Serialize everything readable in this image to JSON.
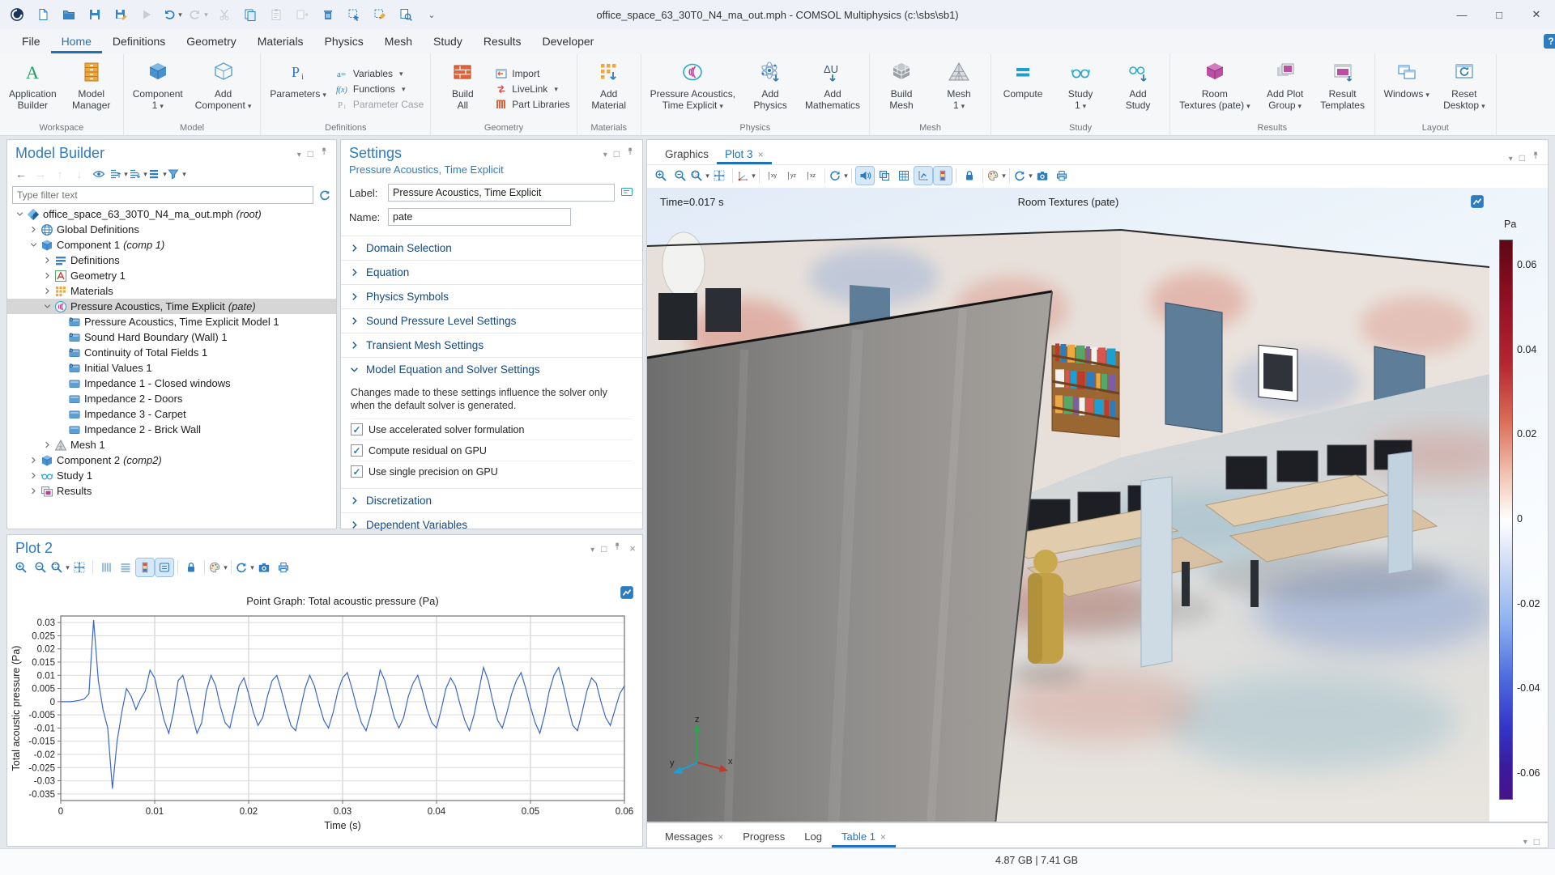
{
  "window": {
    "title": "office_space_63_30T0_N4_ma_out.mph - COMSOL Multiphysics (c:\\sbs\\sb1)",
    "quick_access": [
      {
        "icon": "comsol-logo"
      },
      {
        "icon": "new-file"
      },
      {
        "icon": "open"
      },
      {
        "icon": "save"
      },
      {
        "icon": "save-as"
      },
      {
        "icon": "run",
        "disabled": true
      },
      {
        "icon": "undo",
        "caret": true
      },
      {
        "icon": "redo",
        "caret": true,
        "disabled": true
      },
      {
        "icon": "cut",
        "disabled": true
      },
      {
        "icon": "copy"
      },
      {
        "icon": "paste",
        "disabled": true
      },
      {
        "icon": "duplicate",
        "disabled": true
      },
      {
        "icon": "delete"
      },
      {
        "icon": "select-box"
      },
      {
        "icon": "clear-selection"
      },
      {
        "icon": "find"
      },
      {
        "icon": "more-chevron"
      }
    ],
    "controls": [
      {
        "icon": "minimize",
        "glyph": "—"
      },
      {
        "icon": "maximize",
        "glyph": "□"
      },
      {
        "icon": "close",
        "glyph": "✕"
      }
    ]
  },
  "menu": {
    "items": [
      "File",
      "Home",
      "Definitions",
      "Geometry",
      "Materials",
      "Physics",
      "Mesh",
      "Study",
      "Results",
      "Developer"
    ],
    "active": "Home",
    "help": "?"
  },
  "ribbon": {
    "groups": [
      {
        "label": "Workspace",
        "buttons": [
          {
            "lines": [
              "Application",
              "Builder"
            ],
            "icon": "app-builder"
          },
          {
            "lines": [
              "Model",
              "Manager"
            ],
            "icon": "model-manager"
          }
        ]
      },
      {
        "label": "Model",
        "buttons": [
          {
            "lines": [
              "Component",
              "1"
            ],
            "icon": "component-cube",
            "caret": true
          },
          {
            "lines": [
              "Add",
              "Component"
            ],
            "icon": "add-component",
            "caret": true
          }
        ]
      },
      {
        "label": "Definitions",
        "buttons": [
          {
            "lines": [
              "Parameters"
            ],
            "icon": "parameters",
            "caret": true
          }
        ],
        "small": [
          {
            "label": "Variables",
            "icon": "variables",
            "caret": true
          },
          {
            "label": "Functions",
            "icon": "functions",
            "caret": true
          },
          {
            "label": "Parameter Case",
            "icon": "parameter-case",
            "disabled": true
          }
        ]
      },
      {
        "label": "Geometry",
        "buttons": [
          {
            "lines": [
              "Build",
              "All"
            ],
            "icon": "build-all"
          }
        ],
        "small": [
          {
            "label": "Import",
            "icon": "import"
          },
          {
            "label": "LiveLink",
            "icon": "livelink",
            "caret": true
          },
          {
            "label": "Part Libraries",
            "icon": "part-libraries"
          }
        ]
      },
      {
        "label": "Materials",
        "buttons": [
          {
            "lines": [
              "Add",
              "Material"
            ],
            "icon": "add-material"
          }
        ]
      },
      {
        "label": "Physics",
        "buttons": [
          {
            "lines": [
              "Pressure Acoustics,",
              "Time Explicit"
            ],
            "icon": "acoustics",
            "caret": true
          },
          {
            "lines": [
              "Add",
              "Physics"
            ],
            "icon": "add-physics"
          },
          {
            "lines": [
              "Add",
              "Mathematics"
            ],
            "icon": "add-math"
          }
        ]
      },
      {
        "label": "Mesh",
        "buttons": [
          {
            "lines": [
              "Build",
              "Mesh"
            ],
            "icon": "build-mesh"
          },
          {
            "lines": [
              "Mesh",
              "1"
            ],
            "icon": "mesh-tri",
            "caret": true
          }
        ]
      },
      {
        "label": "Study",
        "buttons": [
          {
            "lines": [
              "Compute"
            ],
            "icon": "compute"
          },
          {
            "lines": [
              "Study",
              "1"
            ],
            "icon": "study-glasses",
            "caret": true
          },
          {
            "lines": [
              "Add",
              "Study"
            ],
            "icon": "add-study"
          }
        ]
      },
      {
        "label": "Results",
        "buttons": [
          {
            "lines": [
              "Room",
              "Textures (pate)"
            ],
            "icon": "room-textures",
            "caret": true
          },
          {
            "lines": [
              "Add Plot",
              "Group"
            ],
            "icon": "add-plot-group",
            "caret": true
          },
          {
            "lines": [
              "Result",
              "Templates"
            ],
            "icon": "result-templates"
          }
        ]
      },
      {
        "label": "Layout",
        "buttons": [
          {
            "lines": [
              "Windows"
            ],
            "icon": "windows-icon",
            "caret": true
          },
          {
            "lines": [
              "Reset",
              "Desktop"
            ],
            "icon": "reset-desktop",
            "caret": true
          }
        ]
      }
    ]
  },
  "model_builder": {
    "title": "Model Builder",
    "toolbar": [
      {
        "icon": "arrow-left"
      },
      {
        "icon": "arrow-right",
        "disabled": true
      },
      {
        "icon": "arrow-up",
        "disabled": true
      },
      {
        "icon": "arrow-down",
        "disabled": true
      },
      {
        "icon": "eye"
      },
      {
        "icon": "expand-all",
        "caret": true
      },
      {
        "icon": "collapse-all",
        "caret": true
      },
      {
        "icon": "columns-icon",
        "caret": true
      },
      {
        "icon": "funnel",
        "caret": true
      }
    ],
    "filter_placeholder": "Type filter text",
    "tree": [
      {
        "depth": 0,
        "icon": "root",
        "label": "office_space_63_30T0_N4_ma_out.mph",
        "suffix": "(root)",
        "state": "expanded"
      },
      {
        "depth": 1,
        "icon": "globe",
        "label": "Global Definitions",
        "state": "collapsed"
      },
      {
        "depth": 1,
        "icon": "component",
        "label": "Component 1",
        "suffix": "(comp 1)",
        "state": "expanded"
      },
      {
        "depth": 2,
        "icon": "definitions",
        "label": "Definitions",
        "state": "collapsed"
      },
      {
        "depth": 2,
        "icon": "geometry",
        "label": "Geometry 1",
        "state": "collapsed"
      },
      {
        "depth": 2,
        "icon": "materials",
        "label": "Materials",
        "state": "collapsed"
      },
      {
        "depth": 2,
        "icon": "physics",
        "label": "Pressure Acoustics, Time Explicit",
        "suffix": "(pate)",
        "state": "expanded",
        "selected": true
      },
      {
        "depth": 3,
        "icon": "node-d",
        "label": "Pressure Acoustics, Time Explicit Model 1"
      },
      {
        "depth": 3,
        "icon": "node-d",
        "label": "Sound Hard Boundary (Wall) 1"
      },
      {
        "depth": 3,
        "icon": "node-d",
        "label": "Continuity of Total Fields 1"
      },
      {
        "depth": 3,
        "icon": "node-d",
        "label": "Initial Values 1"
      },
      {
        "depth": 3,
        "icon": "node",
        "label": "Impedance 1 - Closed windows"
      },
      {
        "depth": 3,
        "icon": "node",
        "label": "Impedance 2 - Doors"
      },
      {
        "depth": 3,
        "icon": "node",
        "label": "Impedance 3 - Carpet"
      },
      {
        "depth": 3,
        "icon": "node",
        "label": "Impedance 2 - Brick Wall"
      },
      {
        "depth": 2,
        "icon": "mesh",
        "label": "Mesh 1",
        "state": "collapsed"
      },
      {
        "depth": 1,
        "icon": "component",
        "label": "Component 2",
        "suffix": "(comp2)",
        "state": "collapsed"
      },
      {
        "depth": 1,
        "icon": "study",
        "label": "Study 1",
        "state": "collapsed"
      },
      {
        "depth": 1,
        "icon": "results",
        "label": "Results",
        "state": "collapsed"
      }
    ]
  },
  "settings": {
    "title": "Settings",
    "subtitle": "Pressure Acoustics, Time Explicit",
    "label_caption": "Label:",
    "label_value": "Pressure Acoustics, Time Explicit",
    "name_caption": "Name:",
    "name_value": "pate",
    "sections": [
      {
        "title": "Domain Selection",
        "state": "collapsed"
      },
      {
        "title": "Equation",
        "state": "collapsed"
      },
      {
        "title": "Physics Symbols",
        "state": "collapsed"
      },
      {
        "title": "Sound Pressure Level Settings",
        "state": "collapsed"
      },
      {
        "title": "Transient Mesh Settings",
        "state": "collapsed"
      },
      {
        "title": "Model Equation and Solver Settings",
        "state": "expanded",
        "note": "Changes made to these settings influence the solver only when the default solver is generated.",
        "checkboxes": [
          {
            "label": "Use accelerated solver formulation",
            "checked": true
          },
          {
            "label": "Compute residual on GPU",
            "checked": true
          },
          {
            "label": "Use single precision on GPU",
            "checked": true
          }
        ]
      },
      {
        "title": "Discretization",
        "state": "collapsed"
      },
      {
        "title": "Dependent Variables",
        "state": "collapsed"
      }
    ]
  },
  "plot2": {
    "title": "Plot 2",
    "toolbar": [
      {
        "icon": "zoom-in"
      },
      {
        "icon": "zoom-out"
      },
      {
        "icon": "zoom-box",
        "caret": true
      },
      {
        "icon": "zoom-extents",
        "sep": true
      },
      {
        "icon": "grid-x"
      },
      {
        "icon": "grid-y"
      },
      {
        "icon": "colorbar-icon",
        "active": true
      },
      {
        "icon": "legend-icon",
        "active": true,
        "sep": true
      },
      {
        "icon": "lock",
        "sep": true
      },
      {
        "icon": "palette",
        "caret": true,
        "sep": true
      },
      {
        "icon": "update",
        "caret": true
      },
      {
        "icon": "camera"
      },
      {
        "icon": "print"
      }
    ],
    "chart_data": {
      "type": "line",
      "title": "Point Graph: Total acoustic pressure (Pa)",
      "xlabel": "Time (s)",
      "ylabel": "Total acoustic pressure (Pa)",
      "xlim": [
        0,
        0.06
      ],
      "ylim": [
        -0.0375,
        0.0325
      ],
      "xticks": [
        0,
        0.01,
        0.02,
        0.03,
        0.04,
        0.05,
        0.06
      ],
      "xtick_labels": [
        "0",
        "0.01",
        "0.02",
        "0.03",
        "0.04",
        "0.05",
        "0.06"
      ],
      "yticks": [
        0.03,
        0.025,
        0.02,
        0.015,
        0.01,
        0.005,
        0,
        -0.005,
        -0.01,
        -0.015,
        -0.02,
        -0.025,
        -0.03,
        -0.035
      ],
      "ytick_labels": [
        "0.03",
        "0.025",
        "0.02",
        "0.015",
        "0.01",
        "0.005",
        "0",
        "-0.005",
        "-0.01",
        "-0.015",
        "-0.02",
        "-0.025",
        "-0.03",
        "-0.035"
      ],
      "grid": true,
      "line_color": "#3a67c8",
      "t_step": 0.0005,
      "values_mPa": [
        0,
        0,
        0,
        0.2,
        0.5,
        1,
        3,
        31,
        8,
        -3,
        -10,
        -33,
        -15,
        -4,
        5,
        2,
        -3,
        1,
        4,
        12,
        9,
        1,
        -7,
        -12,
        -4,
        8,
        10,
        3,
        -5,
        -12,
        -8,
        4,
        10,
        6,
        -2,
        -8,
        -10,
        -2,
        6,
        9,
        3,
        -4,
        -9,
        -6,
        2,
        8,
        10,
        4,
        -3,
        -9,
        -11,
        -3,
        5,
        10,
        6,
        -1,
        -7,
        -10,
        -4,
        4,
        9,
        11,
        5,
        -2,
        -8,
        -11,
        -5,
        3,
        12,
        8,
        1,
        -6,
        -10,
        -6,
        2,
        7,
        10,
        4,
        -3,
        -8,
        -10,
        -3,
        5,
        9,
        6,
        -1,
        -7,
        -11,
        -5,
        4,
        13,
        8,
        0,
        -7,
        -10,
        -4,
        3,
        8,
        11,
        5,
        -2,
        -8,
        -12,
        -5,
        4,
        10,
        13,
        6,
        -2,
        -9,
        -11,
        -4,
        4,
        9,
        7,
        0,
        -6,
        -9,
        -3,
        3,
        6
      ]
    }
  },
  "graphics": {
    "tabs": [
      {
        "label": "Graphics",
        "active": false,
        "closable": false
      },
      {
        "label": "Plot 3",
        "active": true,
        "closable": true
      }
    ],
    "toolbar": [
      {
        "icon": "zoom-in"
      },
      {
        "icon": "zoom-out"
      },
      {
        "icon": "zoom-box",
        "caret": true
      },
      {
        "icon": "zoom-extents",
        "sep": true
      },
      {
        "icon": "default-view",
        "caret": true,
        "sep": true
      },
      {
        "icon": "view-xy"
      },
      {
        "icon": "view-yz"
      },
      {
        "icon": "view-xz",
        "sep": true
      },
      {
        "icon": "rotate",
        "caret": true,
        "sep": true
      },
      {
        "icon": "sound",
        "active": true
      },
      {
        "icon": "transparency"
      },
      {
        "icon": "grid-table"
      },
      {
        "icon": "plot-arrows",
        "active": true
      },
      {
        "icon": "colorbar-icon",
        "active": true,
        "sep": true
      },
      {
        "icon": "lock",
        "sep": true
      },
      {
        "icon": "palette",
        "caret": true,
        "sep": true
      },
      {
        "icon": "update",
        "caret": true
      },
      {
        "icon": "camera"
      },
      {
        "icon": "print"
      }
    ],
    "time_label": "Time=0.017 s",
    "plot_title": "Room Textures (pate)",
    "colorbar": {
      "unit": "Pa",
      "ticks": [
        "0.06",
        "0.04",
        "0.02",
        "0",
        "-0.02",
        "-0.04",
        "-0.06"
      ],
      "max_color": "#5d0713",
      "zero_color": "#ffffff",
      "min_color": "#471388"
    },
    "axis_triad": {
      "x": "x",
      "y": "y",
      "z": "z"
    }
  },
  "bottom_panel": {
    "tabs": [
      {
        "label": "Messages",
        "closable": true,
        "active": false
      },
      {
        "label": "Progress",
        "closable": false,
        "active": false
      },
      {
        "label": "Log",
        "closable": false,
        "active": false
      },
      {
        "label": "Table 1",
        "closable": true,
        "active": true
      }
    ]
  },
  "status_bar": {
    "memory": "4.87 GB | 7.41 GB"
  },
  "colors": {
    "accent": "#2272b8",
    "selection": "#d6d6d6",
    "ribbon_bg": "#f6f7f9"
  }
}
